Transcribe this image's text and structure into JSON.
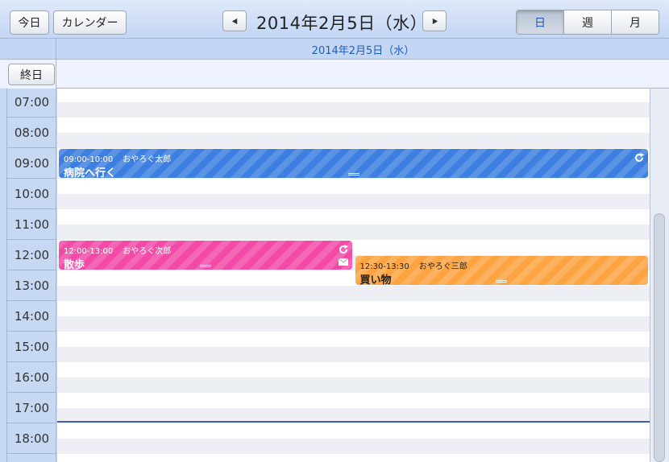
{
  "toolbar": {
    "today": "今日",
    "calendar": "カレンダー",
    "title": "2014年2月5日（水）",
    "prev_icon": "triangle-left-icon",
    "next_icon": "triangle-right-icon",
    "views": [
      {
        "label": "日",
        "active": true
      },
      {
        "label": "週",
        "active": false
      },
      {
        "label": "月",
        "active": false
      }
    ]
  },
  "day_header": "2014年2月5日（水）",
  "all_day_label": "終日",
  "hours": [
    "07:00",
    "08:00",
    "09:00",
    "10:00",
    "11:00",
    "12:00",
    "13:00",
    "14:00",
    "15:00",
    "16:00",
    "17:00",
    "18:00"
  ],
  "events": [
    {
      "time": "09:00-10:00",
      "owner": "おやろぐ太郎",
      "title": "病院へ行く",
      "color": "#3d7fe0",
      "text_color": "#ffffff",
      "start": "09:00",
      "end": "10:00",
      "column": 0,
      "columns": 1,
      "icons": [
        "repeat-icon"
      ]
    },
    {
      "time": "12:00-13:00",
      "owner": "おやろぐ次郎",
      "title": "散歩",
      "color": "#f24aa6",
      "text_color": "#ffffff",
      "start": "12:00",
      "end": "13:00",
      "column": 0,
      "columns": 2,
      "icons": [
        "repeat-icon",
        "mail-icon"
      ]
    },
    {
      "time": "12:30-13:30",
      "owner": "おやろぐ三郎",
      "title": "買い物",
      "color": "#fba441",
      "text_color": "#222222",
      "start": "12:30",
      "end": "13:30",
      "column": 1,
      "columns": 2,
      "icons": []
    }
  ],
  "current_time": "18:00",
  "colors": {
    "accent": "#1f5db3",
    "grid_border": "#9fb6dc"
  }
}
